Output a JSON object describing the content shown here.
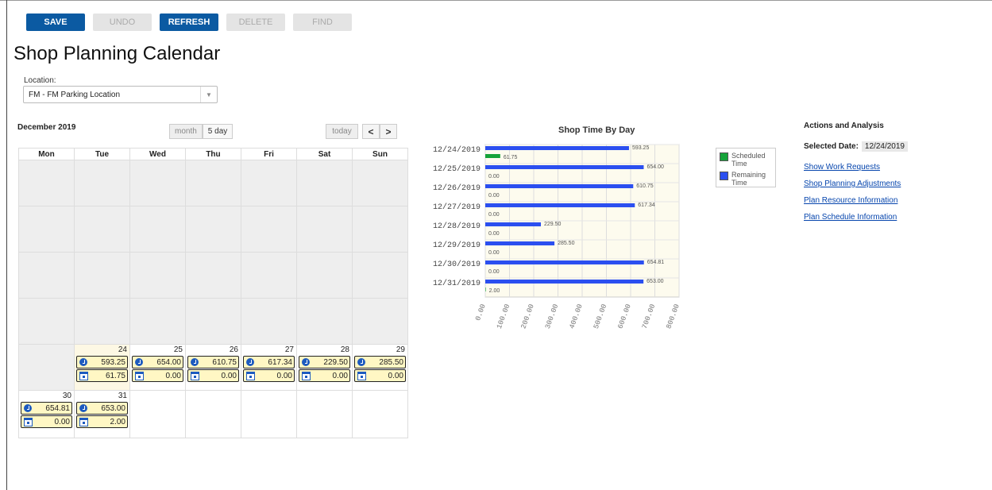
{
  "toolbar": {
    "save": "SAVE",
    "undo": "UNDO",
    "refresh": "REFRESH",
    "delete": "DELETE",
    "find": "FIND"
  },
  "page_title": "Shop Planning Calendar",
  "location": {
    "label": "Location:",
    "value": "FM - FM Parking Location"
  },
  "calendar": {
    "title": "December 2019",
    "views": [
      "month",
      "5 day"
    ],
    "today_label": "today",
    "prev": "<",
    "next": ">",
    "weekdays": [
      "Mon",
      "Tue",
      "Wed",
      "Thu",
      "Fri",
      "Sat",
      "Sun"
    ],
    "days": [
      {
        "day": "24",
        "scheduled": "593.25",
        "remaining": "61.75"
      },
      {
        "day": "25",
        "scheduled": "654.00",
        "remaining": "0.00"
      },
      {
        "day": "26",
        "scheduled": "610.75",
        "remaining": "0.00"
      },
      {
        "day": "27",
        "scheduled": "617.34",
        "remaining": "0.00"
      },
      {
        "day": "28",
        "scheduled": "229.50",
        "remaining": "0.00"
      },
      {
        "day": "29",
        "scheduled": "285.50",
        "remaining": "0.00"
      },
      {
        "day": "30",
        "scheduled": "654.81",
        "remaining": "0.00"
      },
      {
        "day": "31",
        "scheduled": "653.00",
        "remaining": "2.00"
      }
    ]
  },
  "chart_data": {
    "type": "bar",
    "orientation": "horizontal",
    "title": "Shop Time By Day",
    "categories": [
      "12/24/2019",
      "12/25/2019",
      "12/26/2019",
      "12/27/2019",
      "12/28/2019",
      "12/29/2019",
      "12/30/2019",
      "12/31/2019"
    ],
    "series": [
      {
        "name": "Remaining Time",
        "color": "#2b4ff0",
        "values": [
          593.25,
          654.0,
          610.75,
          617.34,
          229.5,
          285.5,
          654.81,
          653.0
        ],
        "labels": [
          "593.25",
          "654.00",
          "610.75",
          "617.34",
          "229.50",
          "285.50",
          "654.81",
          "653.00"
        ]
      },
      {
        "name": "Scheduled Time",
        "color": "#16a33a",
        "values": [
          61.75,
          0.0,
          0.0,
          0.0,
          0.0,
          0.0,
          0.0,
          2.0
        ],
        "labels": [
          "61.75",
          "0.00",
          "0.00",
          "0.00",
          "0.00",
          "0.00",
          "0.00",
          "2.00"
        ]
      }
    ],
    "xlim": [
      0,
      800
    ],
    "xticks": [
      "0.00",
      "100.00",
      "200.00",
      "300.00",
      "400.00",
      "500.00",
      "600.00",
      "700.00",
      "800.00"
    ],
    "legend": [
      "Scheduled Time",
      "Remaining Time"
    ],
    "legend_position": "right",
    "grid": true
  },
  "actions": {
    "title": "Actions and Analysis",
    "selected_date_label": "Selected Date:",
    "selected_date": "12/24/2019",
    "links": [
      "Show Work Requests",
      "Shop Planning Adjustments",
      "Plan Resource Information",
      "Plan Schedule Information"
    ]
  },
  "colors": {
    "primary": "#0b5aa2",
    "remaining_bar": "#2b4ff0",
    "scheduled_bar": "#16a33a",
    "today_bg": "#fdf8e4",
    "chip_bg": "#fff7c4"
  }
}
